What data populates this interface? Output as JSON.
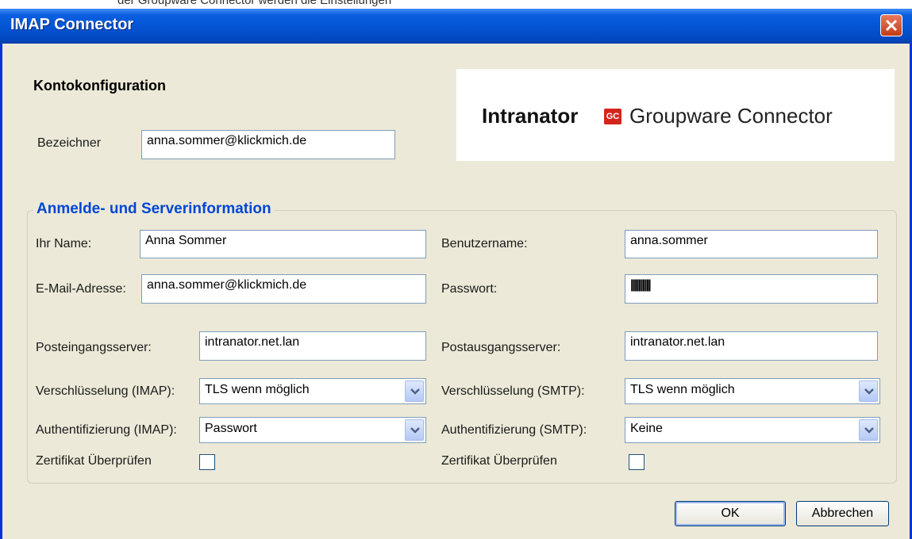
{
  "window": {
    "title": "IMAP Connector",
    "top_strip_text": "der Groupware Connector werden die Einstellungen"
  },
  "account": {
    "heading": "Kontokonfiguration",
    "identifier_label": "Bezeichner",
    "identifier_value": "anna.sommer@klickmich.de"
  },
  "logo": {
    "brand": "Intranator",
    "badge": "GC",
    "product": "Groupware Connector"
  },
  "server": {
    "group_title": "Anmelde- und Serverinformation",
    "name_label": "Ihr Name:",
    "name_value": "Anna Sommer",
    "email_label": "E-Mail-Adresse:",
    "email_value": "anna.sommer@klickmich.de",
    "username_label": "Benutzername:",
    "username_value": "anna.sommer",
    "password_label": "Passwort:",
    "password_value": "||||||||||",
    "incoming_label": "Posteingangsserver:",
    "incoming_value": "intranator.net.lan",
    "outgoing_label": "Postausgangsserver:",
    "outgoing_value": "intranator.net.lan",
    "enc_imap_label": "Verschlüsselung (IMAP):",
    "enc_imap_value": "TLS wenn möglich",
    "enc_smtp_label": "Verschlüsselung (SMTP):",
    "enc_smtp_value": "TLS wenn möglich",
    "auth_imap_label": "Authentifizierung (IMAP):",
    "auth_imap_value": "Passwort",
    "auth_smtp_label": "Authentifizierung (SMTP):",
    "auth_smtp_value": "Keine",
    "cert_imap_label": "Zertifikat Überprüfen",
    "cert_smtp_label": "Zertifikat Überprüfen"
  },
  "buttons": {
    "ok": "OK",
    "cancel": "Abbrechen"
  }
}
